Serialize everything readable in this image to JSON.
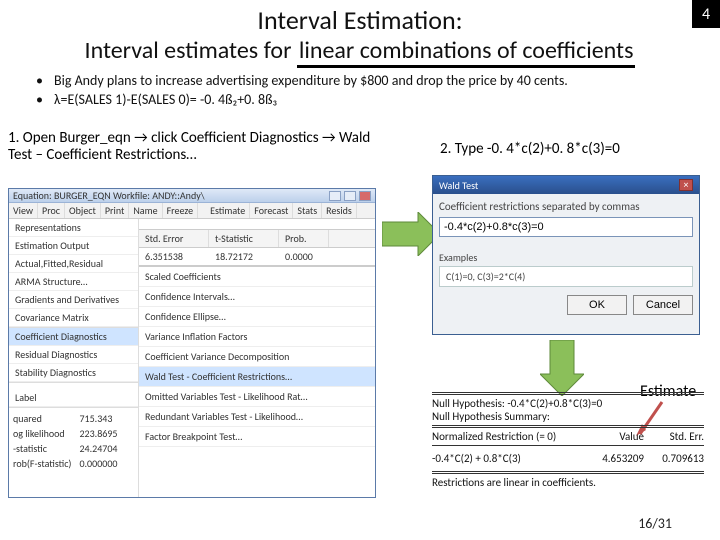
{
  "badge": "4",
  "title": "Interval Estimation:",
  "subtitle_prefix": "Interval estimates for ",
  "subtitle_under": "linear combinations of coefficients",
  "bullets": {
    "b1": "Big Andy plans to increase advertising expenditure by $800 and drop the price by 40 cents.",
    "b2": "λ=E(SALES 1)-E(SALES 0)= -0. 4ß₂+0. 8ß₃"
  },
  "step1": "1. Open Burger_eqn → click Coefficient Diagnostics → Wald Test – Coefficient Restrictions…",
  "step2": "2. Type -0. 4*c(2)+0. 8*c(3)=0",
  "win1": {
    "caption": "Equation: BURGER_EQN   Workfile: ANDY::Andy\\",
    "toolbarA": [
      "View",
      "Proc",
      "Object",
      "Print",
      "Name",
      "Freeze"
    ],
    "toolbarB": [
      "Estimate",
      "Forecast",
      "Stats",
      "Resids"
    ],
    "reps": [
      "Representations",
      "Estimation Output",
      "Actual,Fitted,Residual",
      "ARMA Structure…",
      "Gradients and Derivatives",
      "Covariance Matrix"
    ],
    "diag_hi": "Coefficient Diagnostics",
    "diags": [
      "Residual Diagnostics",
      "Stability Diagnostics"
    ],
    "lower_left": [
      "Label"
    ],
    "stats": [
      [
        "quared",
        "715.343"
      ],
      [
        "og likelihood",
        "223.8695"
      ],
      [
        "-statistic",
        "24.24704"
      ],
      [
        "rob(F-statistic)",
        "0.000000"
      ]
    ],
    "grid_headers": [
      "Std. Error",
      "t-Statistic",
      "Prob."
    ],
    "grid_row": [
      "6.351538",
      "18.72172",
      "0.0000"
    ],
    "coef_menu": [
      "Scaled Coefficients",
      "Confidence Intervals…",
      "Confidence Ellipse…",
      "Variance Inflation Factors",
      "Coefficient Variance Decomposition",
      "Wald Test - Coefficient Restrictions…",
      "Omitted Variables Test - Likelihood Rat…",
      "Redundant Variables Test - Likelihood…",
      "Factor Breakpoint Test…"
    ]
  },
  "win2": {
    "caption": "Wald Test",
    "label": "Coefficient restrictions separated by commas",
    "value": "-0.4*c(2)+0.8*c(3)=0",
    "examples_title": "Examples",
    "examples": "C(1)=0, C(3)=2*C(4)",
    "ok": "OK",
    "cancel": "Cancel"
  },
  "estimate_label": "Estimate",
  "wald": {
    "line1": "Null Hypothesis: -0.4*C(2)+0.8*C(3)=0",
    "line2": "Null Hypothesis Summary:",
    "h1": "Normalized Restriction (= 0)",
    "h2": "Value",
    "h3": "Std. Err.",
    "r1": "-0.4*C(2) + 0.8*C(3)",
    "r2": "4.653209",
    "r3": "0.709613",
    "foot": "Restrictions are linear in coefficients."
  },
  "pagenum": "16/31"
}
